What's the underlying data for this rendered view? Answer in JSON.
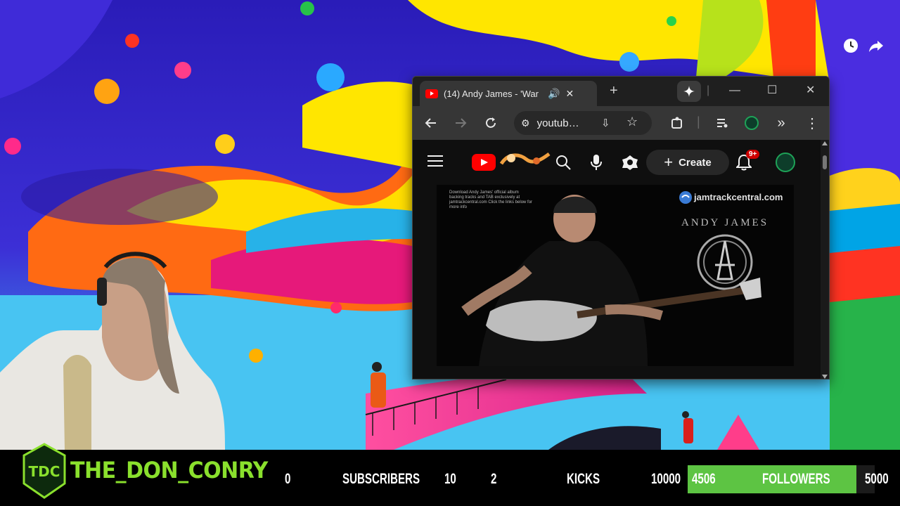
{
  "window": {
    "tab_title": "(14) Andy James - 'War",
    "url": "youtub…"
  },
  "youtube": {
    "create_label": "Create",
    "notification_count": "9+"
  },
  "video": {
    "note": "Download Andy James' official album backing tracks and TAB exclusively at jamtrackcentral.com Click the links below for more info",
    "brand_text": "jamtrackcentral.com",
    "artist_text": "ANDY JAMES"
  },
  "overlay": {
    "channel_name": "THE_DON_CONRY",
    "logo_text": "TDC",
    "subscribers": {
      "current": "0",
      "label": "SUBSCRIBERS",
      "goal": "10"
    },
    "kicks": {
      "current": "2",
      "label": "KICKS",
      "goal": "10000"
    },
    "followers": {
      "current": "4506",
      "label": "FOLLOWERS",
      "goal": "5000",
      "progress": 0.9012
    }
  },
  "colors": {
    "accent_green": "#8ae02d",
    "progress_green": "#5dc443",
    "youtube_red": "#ff0000"
  }
}
